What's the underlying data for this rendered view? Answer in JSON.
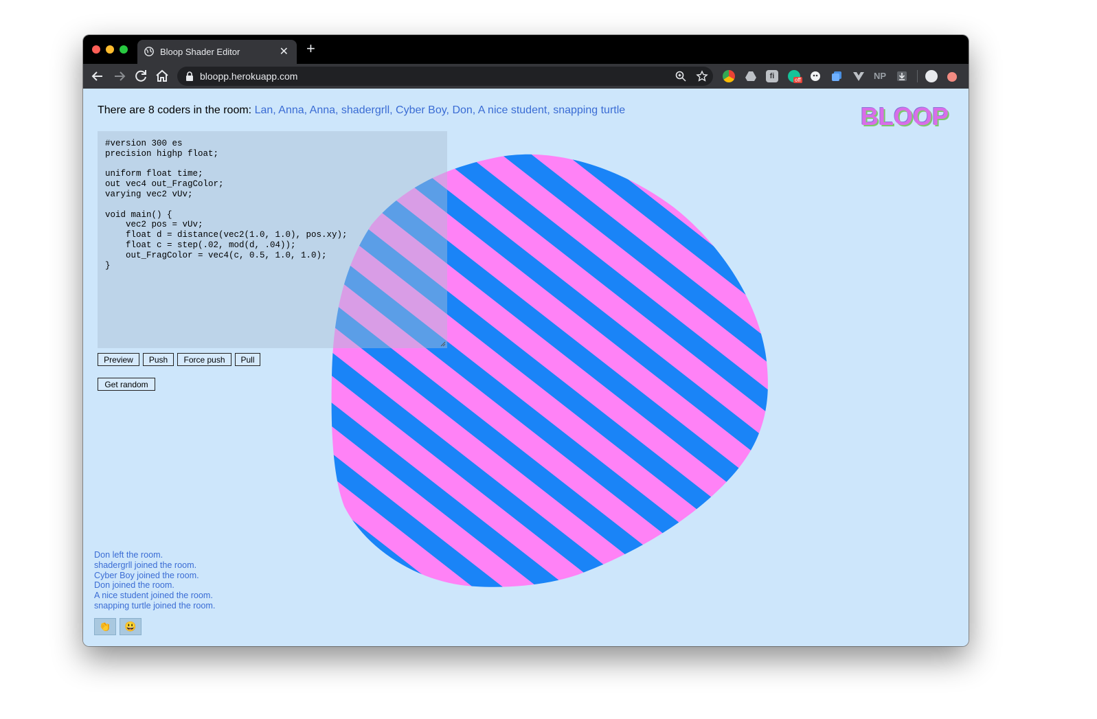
{
  "browser": {
    "tab_title": "Bloop Shader Editor",
    "tab_close": "✕",
    "new_tab": "+",
    "url": "bloopp.herokuapp.com",
    "extensions": [
      "chrome-icon",
      "drive-icon",
      "fn-icon",
      "grammarly-icon",
      "ghost-icon",
      "copy-icon",
      "vue-icon",
      "np-icon",
      "download-icon"
    ],
    "np_label": "NP",
    "grammarly_badge": "off"
  },
  "page": {
    "coders_prefix": "There are 8 coders in the room: ",
    "coders_names": "Lan, Anna, Anna, shadergrll, Cyber Boy, Don, A nice student, snapping turtle",
    "logo": "BLOOP",
    "code": "#version 300 es\nprecision highp float;\n\nuniform float time;\nout vec4 out_FragColor;\nvarying vec2 vUv;\n\nvoid main() {\n    vec2 pos = vUv;\n    float d = distance(vec2(1.0, 1.0), pos.xy);\n    float c = step(.02, mod(d, .04));\n    out_FragColor = vec4(c, 0.5, 1.0, 1.0);\n}",
    "buttons": {
      "preview": "Preview",
      "push": "Push",
      "force_push": "Force push",
      "pull": "Pull",
      "get_random": "Get random"
    },
    "log": [
      "Don left the room.",
      "shadergrll joined the room.",
      "Cyber Boy joined the room.",
      "Don joined the room.",
      "A nice student joined the room.",
      "snapping turtle joined the room."
    ],
    "emoji": {
      "clap": "👏",
      "smile": "😃"
    },
    "colors": {
      "stripe_blue": "#1a84f7",
      "stripe_pink": "#ff82f6",
      "background": "#cde6fb",
      "link": "#3a6cd4"
    }
  }
}
